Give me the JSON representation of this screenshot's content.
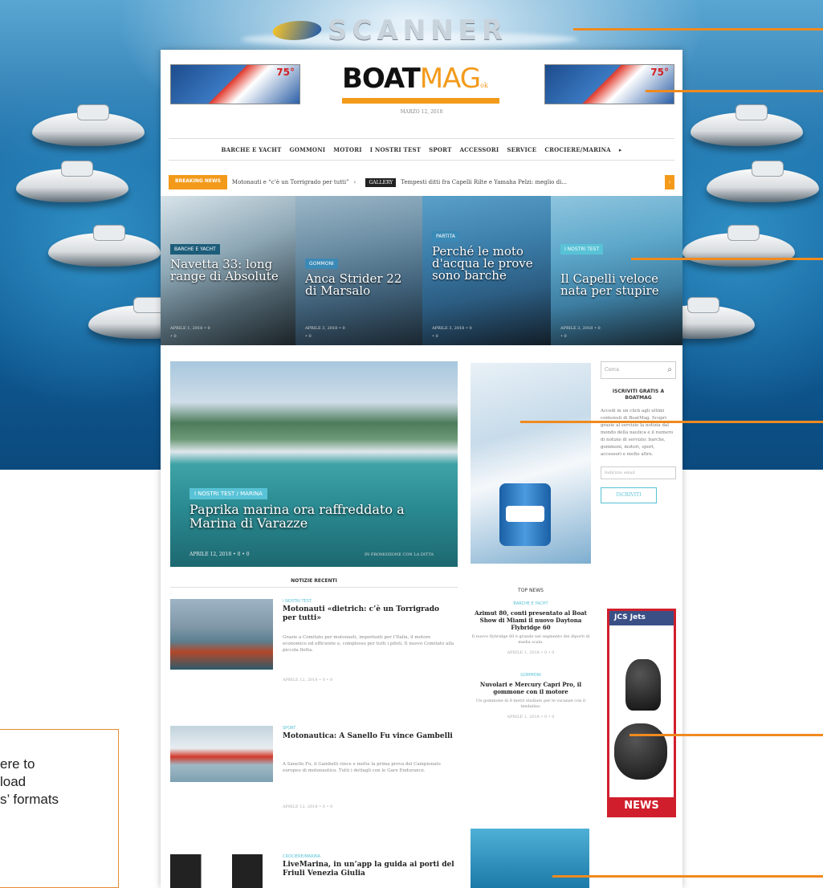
{
  "brand_logo": "SCANNER",
  "site": {
    "logo_bold": "BOAT",
    "logo_light": "MAG",
    "logo_sup": "ok",
    "date": "MARZO 12, 2018",
    "banner_badge": "75°"
  },
  "nav": [
    "BARCHE E YACHT",
    "GOMMONI",
    "MOTORI",
    "I NOSTRI TEST",
    "SPORT",
    "ACCESSORI",
    "SERVICE",
    "CROCIERE/MARINA",
    "▸"
  ],
  "ticker": {
    "label": "BREAKING NEWS",
    "item1": "Motonauti e “c’è un Torrigrado per tutti”",
    "sep": "‹",
    "gallery": "GALLERY",
    "item2": "Tempesti ditti fra Capelli Rilte e Yamaha Pelzi: meglio di...",
    "arrow": "›"
  },
  "featured": [
    {
      "cat": "BARCHE E YACHT",
      "title": "Navetta 33: long range di Absolute",
      "meta": "APRILE 1, 2018 • 0",
      "meta2": "• 0"
    },
    {
      "cat": "GOMMONI",
      "title": "Anca Strider 22 di Marsalo",
      "meta": "APRILE 3, 2018 • 0",
      "meta2": "• 0"
    },
    {
      "cat": "PARTITA",
      "title": "Perché le moto d'acqua le prove sono barche",
      "meta": "APRILE 3, 2018 • 0",
      "meta2": "• 0"
    },
    {
      "cat": "I NOSTRI TEST",
      "title": "Il Capelli veloce nata per stupire",
      "meta": "APRILE 3, 2018 • 0",
      "meta2": "• 0"
    }
  ],
  "big_story": {
    "cat": "I NOSTRI TEST / MARINA",
    "title": "Paprika marina ora raffreddato a Marina di Varazze",
    "meta": "APRILE 12, 2018 • 0 • 0",
    "credit": "IN PROMOZIONE CON LA DITTA"
  },
  "sidebar": {
    "search_placeholder": "Cerca",
    "search_icon": "⌕",
    "sub_title": "ISCRIVITI GRATIS A BOATMAG",
    "sub_text": "Accedi in un click agli ultimi contenuti di BoatMag. Scopri grazie al servizio la notizia dal mondo della nautica e il numero di notizie di servizio: barche, gommoni, motori, sport, accessori e molto altro.",
    "email_placeholder": "Indirizzo email",
    "sub_button": "ISCRIVITI"
  },
  "ad_jcs": {
    "head": "JCS Jets",
    "footer": "NEWS"
  },
  "section_title": "NOTIZIE RECENTI",
  "news": [
    {
      "cat": "I NOSTRI TEST",
      "title": "Motonauti «dietrich: c’è un Torrigrado per tutti»",
      "excerpt": "Grazie a Comitato per motonauti, importanti per l’Italia, il motore economico ed efficiente e, complesso per tutti i piloti. Il nuovo Comitato alla piccola flotta.",
      "meta": "APRILE 12, 2018 • 0 • 0"
    },
    {
      "cat": "SPORT",
      "title": "Motonautica: A Sanello Fu vince Gambelli",
      "excerpt": "A Sanello Fu, il Gambelli vince e mette la prima prova del Campionato europeo di motonautica. Tutti i dettagli con le Gare Endurance.",
      "meta": "APRILE 12, 2018 • 0 • 0"
    },
    {
      "cat": "CROCIERE/MARINA",
      "title": "LiveMarina, in un’app la guida ai porti del Friuli Venezia Giulia",
      "excerpt": "",
      "meta": ""
    }
  ],
  "top_news": {
    "head": "TOP NEWS",
    "items": [
      {
        "cat": "BARCHE E YACHT",
        "title": "Azimut 80, conti presentato al Boat Show di Miami il nuovo Daytona Flybridge 60",
        "excerpt": "Il nuovo flybridge 60 è grande nel segmento dei diporti di media scala.",
        "meta": "APRILE 1, 2018 • 0 • 0"
      },
      {
        "cat": "GOMMONI",
        "title": "Nuvolari e Mercury Capri Pro, il gommone con il motore",
        "excerpt": "Un gommone di 8 metri studiato per le vacanze con il tendalino.",
        "meta": "APRILE 1, 2018 • 0 • 0"
      }
    ]
  },
  "download_box": {
    "text": "ere to\nload\ns’ formats"
  },
  "colors": {
    "accent": "#f39a1b",
    "callout": "#f08a1e",
    "category": "#58c2d6",
    "ad_red": "#d01e2c"
  }
}
